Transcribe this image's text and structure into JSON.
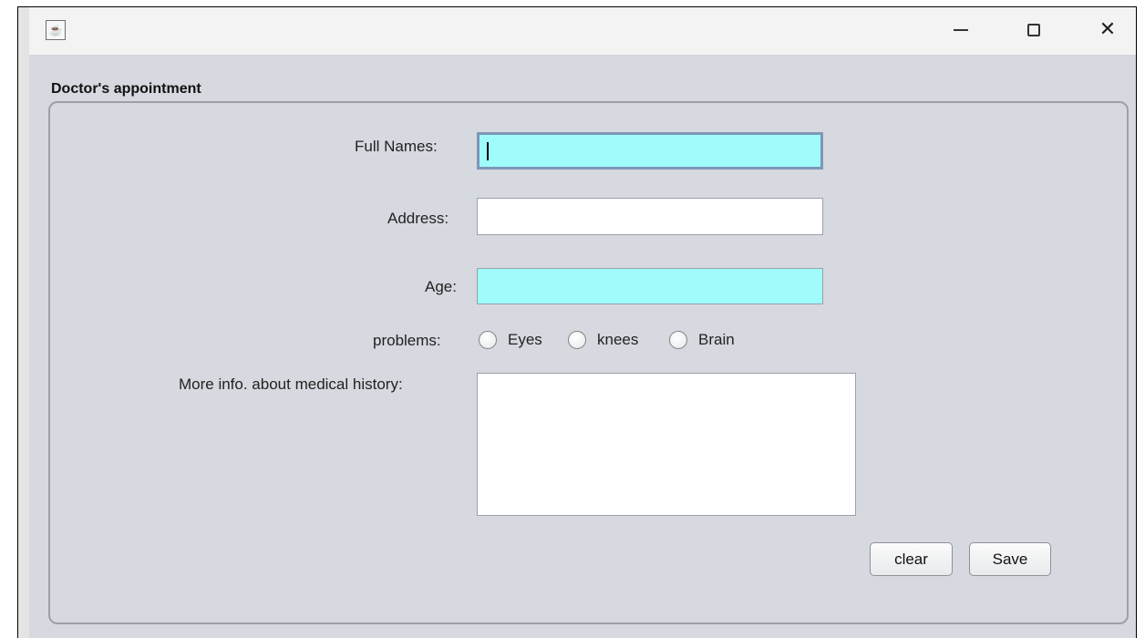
{
  "window": {
    "title": "",
    "buttons": {
      "minimize": "—",
      "maximize": "☐",
      "close": "✕"
    }
  },
  "form": {
    "group_title": "Doctor's appointment",
    "labels": {
      "full_names": "Full Names:",
      "address": "Address:",
      "age": "Age:",
      "problems": "problems:",
      "history": "More info. about medical history:"
    },
    "values": {
      "full_names": "",
      "address": "",
      "age": "",
      "history": ""
    },
    "problem_options": [
      "Eyes",
      "knees",
      "Brain"
    ],
    "buttons": {
      "clear": "clear",
      "save": "Save"
    }
  },
  "icons": {
    "app": "java-icon",
    "minimize": "minimize-icon",
    "maximize": "maximize-icon",
    "close": "close-icon",
    "radio": "radio-button-icon"
  },
  "colors": {
    "field_highlight": "#9ffcfb",
    "panel_bg": "#d6d9df",
    "titlebar_bg": "#f3f3f3"
  }
}
